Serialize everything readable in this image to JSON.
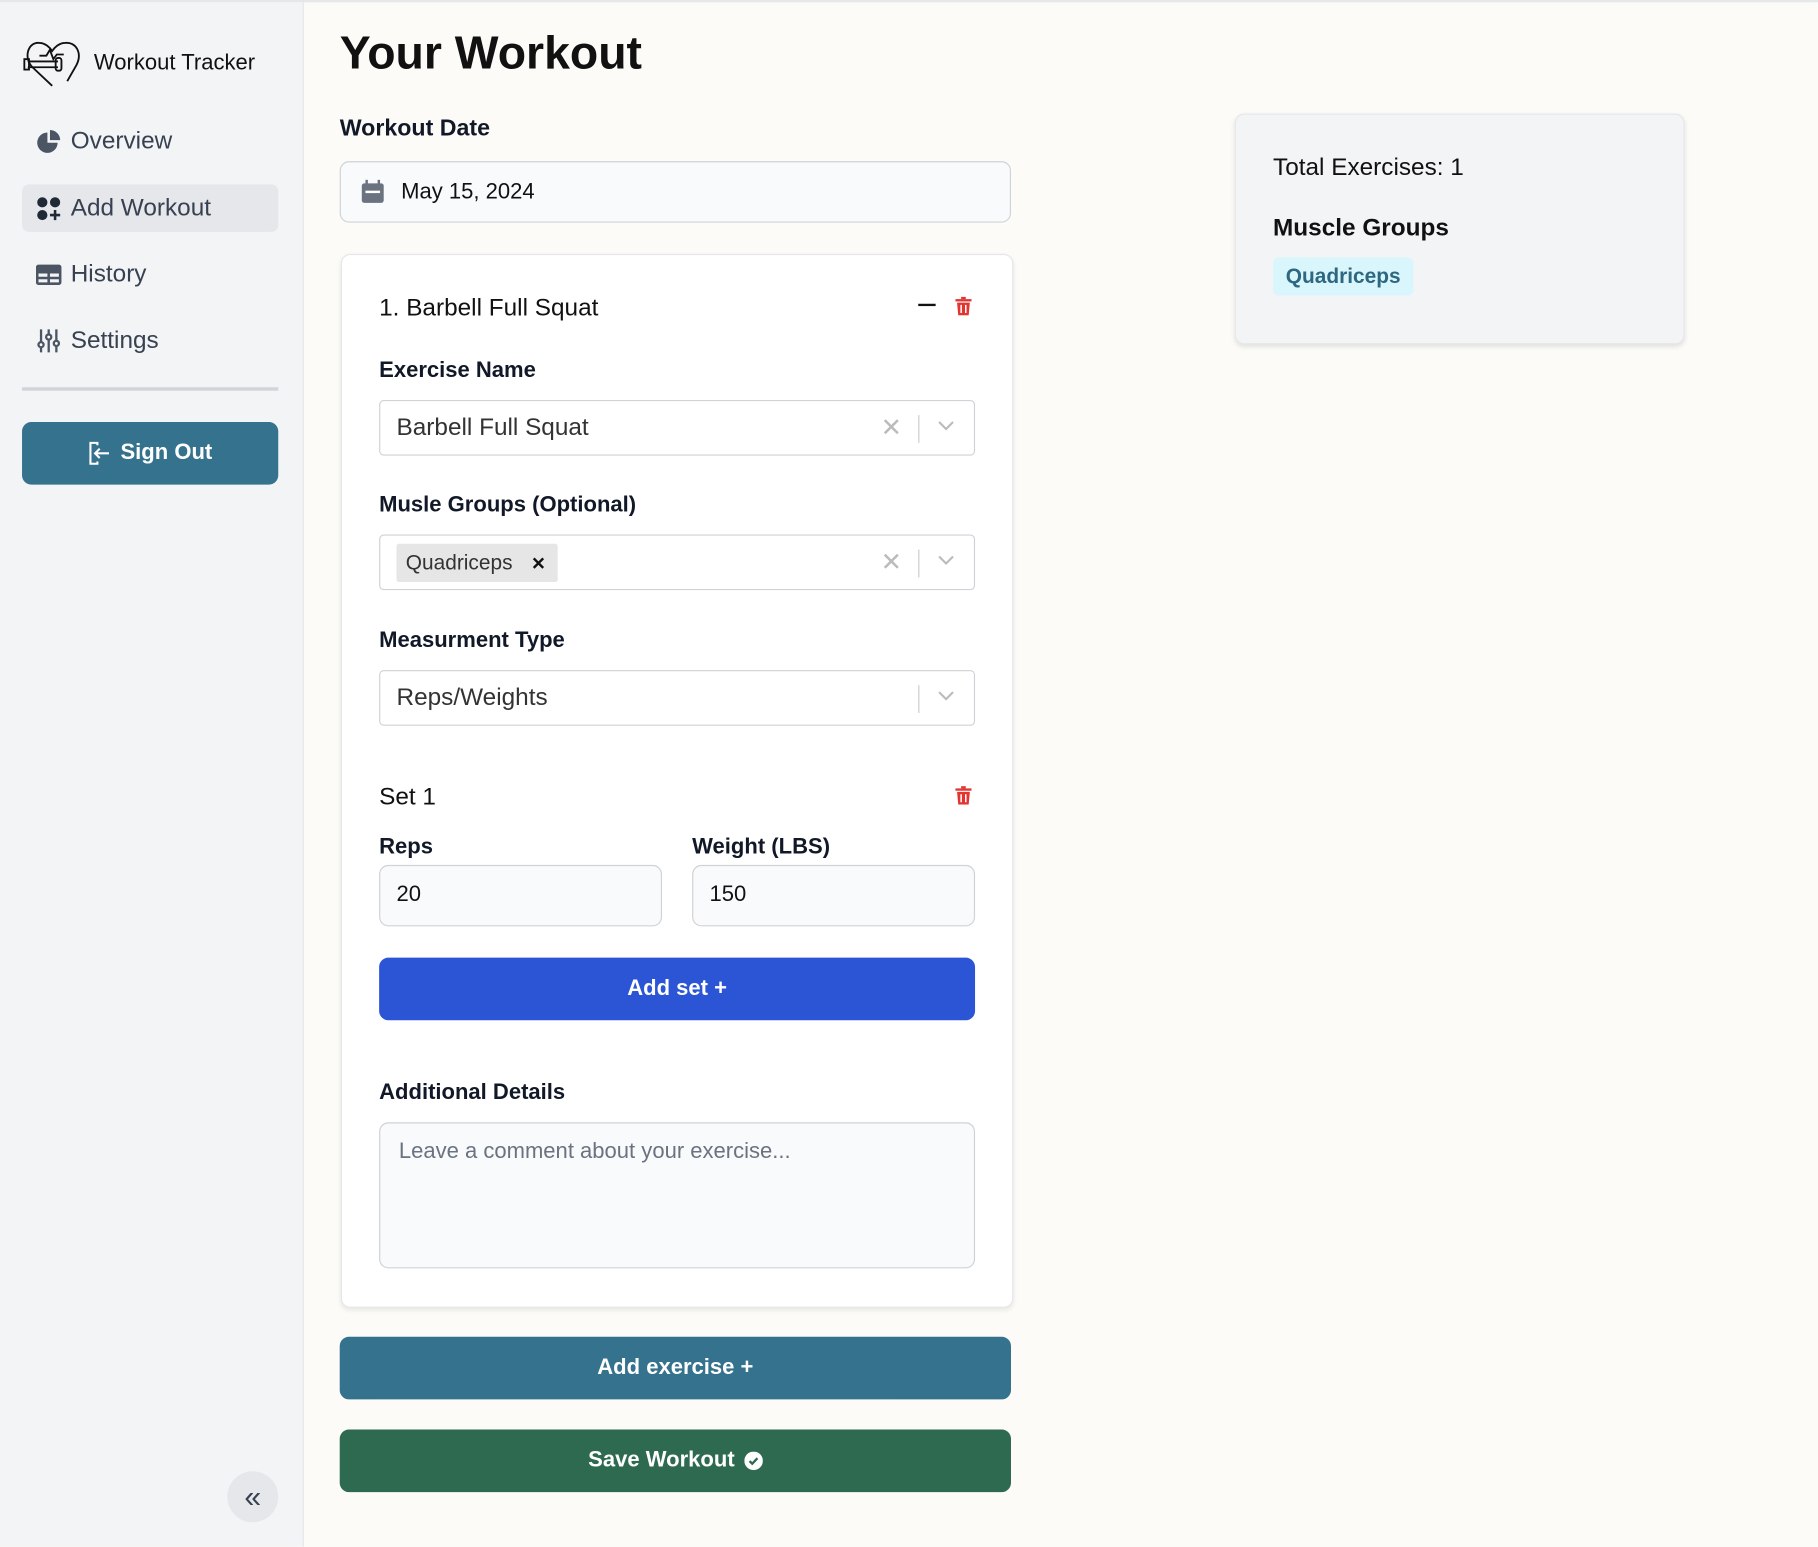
{
  "app": {
    "title": "Workout Tracker"
  },
  "sidebar": {
    "items": [
      {
        "label": "Overview"
      },
      {
        "label": "Add Workout"
      },
      {
        "label": "History"
      },
      {
        "label": "Settings"
      }
    ],
    "sign_out": "Sign Out"
  },
  "page": {
    "title": "Your Workout",
    "date_label": "Workout Date",
    "date_value": "May 15, 2024"
  },
  "exercise": {
    "title": "1. Barbell Full Squat",
    "name_label": "Exercise Name",
    "name_value": "Barbell Full Squat",
    "muscle_label": "Musle Groups (Optional)",
    "muscle_tags": [
      "Quadriceps"
    ],
    "measurement_label": "Measurment Type",
    "measurement_value": "Reps/Weights",
    "set_title": "Set 1",
    "reps_label": "Reps",
    "reps_value": "20",
    "weight_label": "Weight (LBS)",
    "weight_value": "150",
    "add_set": "Add set +",
    "details_label": "Additional Details",
    "details_placeholder": "Leave a comment about your exercise..."
  },
  "actions": {
    "add_exercise": "Add exercise +",
    "save_workout": "Save Workout"
  },
  "summary": {
    "total": "Total Exercises: 1",
    "muscle_title": "Muscle Groups",
    "tags": [
      "Quadriceps"
    ]
  },
  "colors": {
    "teal": "#35728d",
    "blue": "#2c55d6",
    "green": "#2e6a4f",
    "red": "#e3342f"
  }
}
